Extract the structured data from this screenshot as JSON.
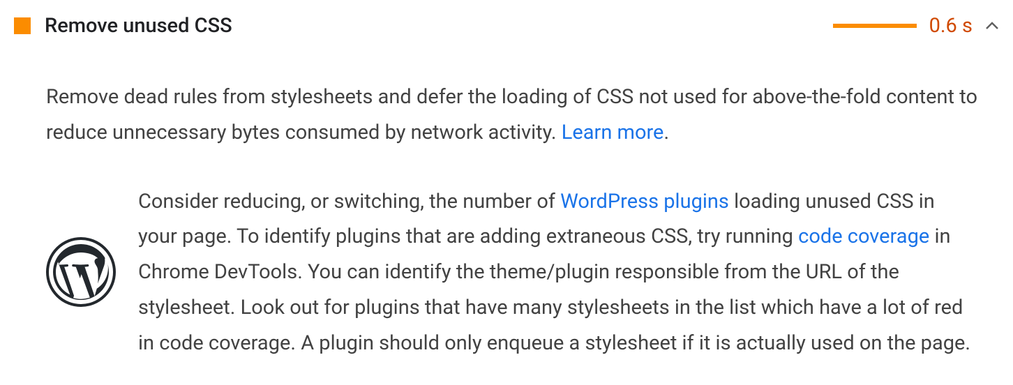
{
  "audit": {
    "title": "Remove unused CSS",
    "savings": "0.6 s",
    "description_before_link": "Remove dead rules from stylesheets and defer the loading of CSS not used for above-the-fold content to reduce unnecessary bytes consumed by network activity. ",
    "learn_more": "Learn more",
    "description_after_link": "."
  },
  "stackpack": {
    "text1": "Consider reducing, or switching, the number of ",
    "link1": "WordPress plugins",
    "text2": " loading unused CSS in your page. To identify plugins that are adding extraneous CSS, try running ",
    "link2": "code coverage",
    "text3": " in Chrome DevTools. You can identify the theme/plugin responsible from the URL of the stylesheet. Look out for plugins that have many stylesheets in the list which have a lot of red in code coverage. A plugin should only enqueue a stylesheet if it is actually used on the page."
  }
}
